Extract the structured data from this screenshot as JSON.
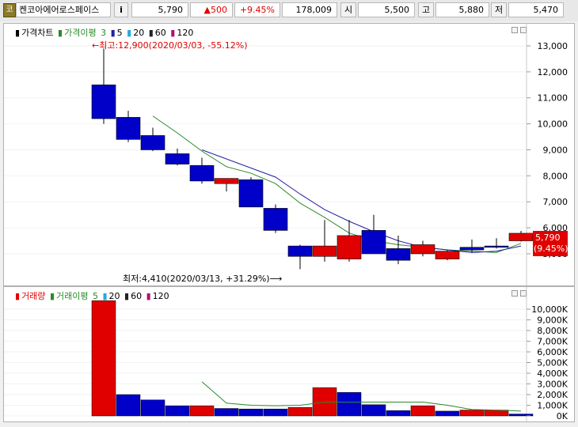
{
  "topbar": {
    "badge": "코",
    "stock_name": "켄코아에어로스페이스",
    "info_icon": "i",
    "price": "5,790",
    "change": "▲500",
    "change_pct": "+9.45%",
    "volume": "178,009",
    "open_label": "시",
    "open": "5,500",
    "high_label": "고",
    "high": "5,880",
    "low_label": "저",
    "low": "5,470"
  },
  "price_panel": {
    "legend": {
      "title": "가격차트",
      "ma_label": "가격이평",
      "ma_periods": [
        "3",
        "5",
        "20",
        "60",
        "120"
      ]
    },
    "max_annotation": "←최고:12,900(2020/03/03, -55.12%)",
    "min_annotation": "최저:4,410(2020/03/13, +31.29%)⟶",
    "last_price_label": "5,790",
    "last_pct_label": "(9.45%)"
  },
  "volume_panel": {
    "legend": {
      "title": "거래량",
      "ma_label": "거래이평",
      "ma_periods": [
        "5",
        "20",
        "60",
        "120"
      ]
    }
  },
  "colors": {
    "up": "#e00000",
    "down": "#0000c8",
    "ma_short": "#2a8a2a",
    "ma_mid": "#2020a0",
    "badge": "#8a7a2a"
  },
  "chart_data": [
    {
      "type": "candlestick",
      "title": "가격차트",
      "y_ticks": [
        "13,000",
        "12,000",
        "11,000",
        "10,000",
        "9,000",
        "8,000",
        "7,000",
        "6,000",
        "5,000"
      ],
      "ylim": [
        4300,
        13700
      ],
      "candles": [
        {
          "o": 11500,
          "h": 12900,
          "l": 10000,
          "c": 10200
        },
        {
          "o": 10250,
          "h": 10500,
          "l": 9300,
          "c": 9400
        },
        {
          "o": 9550,
          "h": 9850,
          "l": 8950,
          "c": 9000
        },
        {
          "o": 8850,
          "h": 9050,
          "l": 8400,
          "c": 8450
        },
        {
          "o": 8400,
          "h": 8700,
          "l": 7700,
          "c": 7800
        },
        {
          "o": 7700,
          "h": 7900,
          "l": 7400,
          "c": 7900
        },
        {
          "o": 7850,
          "h": 7950,
          "l": 6800,
          "c": 6800
        },
        {
          "o": 6750,
          "h": 6900,
          "l": 5800,
          "c": 5900
        },
        {
          "o": 5300,
          "h": 5350,
          "l": 4410,
          "c": 4900
        },
        {
          "o": 4900,
          "h": 6300,
          "l": 4700,
          "c": 5300
        },
        {
          "o": 4800,
          "h": 6300,
          "l": 4700,
          "c": 5700
        },
        {
          "o": 5900,
          "h": 6500,
          "l": 5000,
          "c": 5000
        },
        {
          "o": 5200,
          "h": 5700,
          "l": 4600,
          "c": 4750
        },
        {
          "o": 5000,
          "h": 5500,
          "l": 4900,
          "c": 5350
        },
        {
          "o": 4800,
          "h": 5150,
          "l": 4750,
          "c": 5100
        },
        {
          "o": 5250,
          "h": 5550,
          "l": 5050,
          "c": 5150
        },
        {
          "o": 5300,
          "h": 5600,
          "l": 5200,
          "c": 5250
        },
        {
          "o": 5500,
          "h": 5880,
          "l": 5470,
          "c": 5790
        }
      ],
      "ma_short": [
        null,
        null,
        10300,
        9650,
        8950,
        8350,
        8100,
        7700,
        6950,
        6400,
        5800,
        5500,
        5350,
        5250,
        5150,
        5100,
        5050,
        5400
      ],
      "ma_mid": [
        null,
        null,
        null,
        null,
        9000,
        8650,
        8300,
        7950,
        7300,
        6700,
        6250,
        5850,
        5500,
        5250,
        5150,
        5050,
        5100,
        5300
      ],
      "last_price": 5790
    },
    {
      "type": "bar",
      "title": "거래량",
      "y_ticks": [
        "10,000K",
        "9,000K",
        "8,000K",
        "7,000K",
        "6,000K",
        "5,000K",
        "4,000K",
        "3,000K",
        "2,000K",
        "1,000K",
        "0K"
      ],
      "ylim": [
        0,
        11000
      ],
      "values": [
        10800,
        2000,
        1500,
        950,
        950,
        700,
        650,
        650,
        800,
        2650,
        2200,
        1050,
        500,
        950,
        450,
        550,
        550,
        180
      ],
      "ma_short": [
        null,
        null,
        null,
        null,
        3200,
        1200,
        1000,
        950,
        1000,
        1300,
        1300,
        1300,
        1300,
        1300,
        1000,
        600,
        550,
        450
      ],
      "directions": [
        "up",
        "down",
        "down",
        "down",
        "up",
        "down",
        "down",
        "down",
        "up",
        "up",
        "down",
        "down",
        "down",
        "up",
        "down",
        "up",
        "up",
        "down"
      ]
    }
  ]
}
